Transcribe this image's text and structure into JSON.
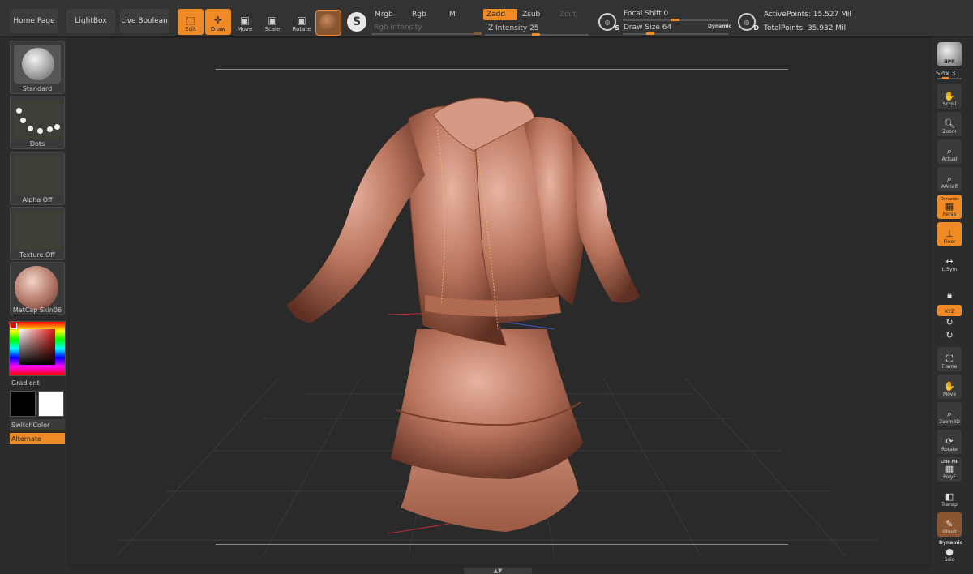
{
  "colors": {
    "accent": "#f08a24",
    "background": "#2b2b2b",
    "model": "#b9745c"
  },
  "topbar": {
    "home": "Home Page",
    "lightbox": "LightBox",
    "liveboolean": "Live Boolean",
    "edit": "Edit",
    "draw": "Draw",
    "move": "Move",
    "scale": "Scale",
    "rotate": "Rotate",
    "modes": {
      "mrgb": "Mrgb",
      "rgb": "Rgb",
      "m": "M",
      "zadd": "Zadd",
      "zsub": "Zsub",
      "zcut": "Zcut"
    },
    "rgb_intensity": "Rgb Intensity",
    "z_intensity_label": "Z Intensity",
    "z_intensity_value": "25",
    "focal_label": "Focal Shift",
    "focal_value": "0",
    "draw_size_label": "Draw Size",
    "draw_size_value": "64",
    "dynamic": "Dynamic",
    "s_key": "S",
    "d_key": "D",
    "active_points": "ActivePoints: 15.527 Mil",
    "total_points": "TotalPoints: 35.932 Mil"
  },
  "left": {
    "brush": "Standard",
    "stroke": "Dots",
    "alpha": "Alpha Off",
    "texture": "Texture Off",
    "material": "MatCap Skin06",
    "gradient": "Gradient",
    "switchcolor": "SwitchColor",
    "alternate": "Alternate"
  },
  "right": {
    "bpr": "BPR",
    "spix_label": "SPix",
    "spix_value": "3",
    "scroll": "Scroll",
    "zoom": "Zoom",
    "actual": "Actual",
    "aahalf": "AAHalf",
    "dynamic_top": "Dynamic",
    "persp": "Persp",
    "floor": "Floor",
    "lsym": "L.Sym",
    "xyz": "XYZ",
    "frame": "Frame",
    "move": "Move",
    "zoom3d": "Zoom3D",
    "rotate": "Rotate",
    "linefill": "Line Fill",
    "polyf": "PolyF",
    "transp": "Transp",
    "ghost": "Ghost",
    "dynamic_bottom": "Dynamic",
    "solo": "Solo"
  },
  "icons": [
    "edit-icon",
    "draw-icon",
    "move-icon",
    "scale-icon",
    "rotate-icon",
    "hand-icon",
    "magnifier-icon",
    "floor-icon",
    "symmetry-icon",
    "frame-icon"
  ]
}
